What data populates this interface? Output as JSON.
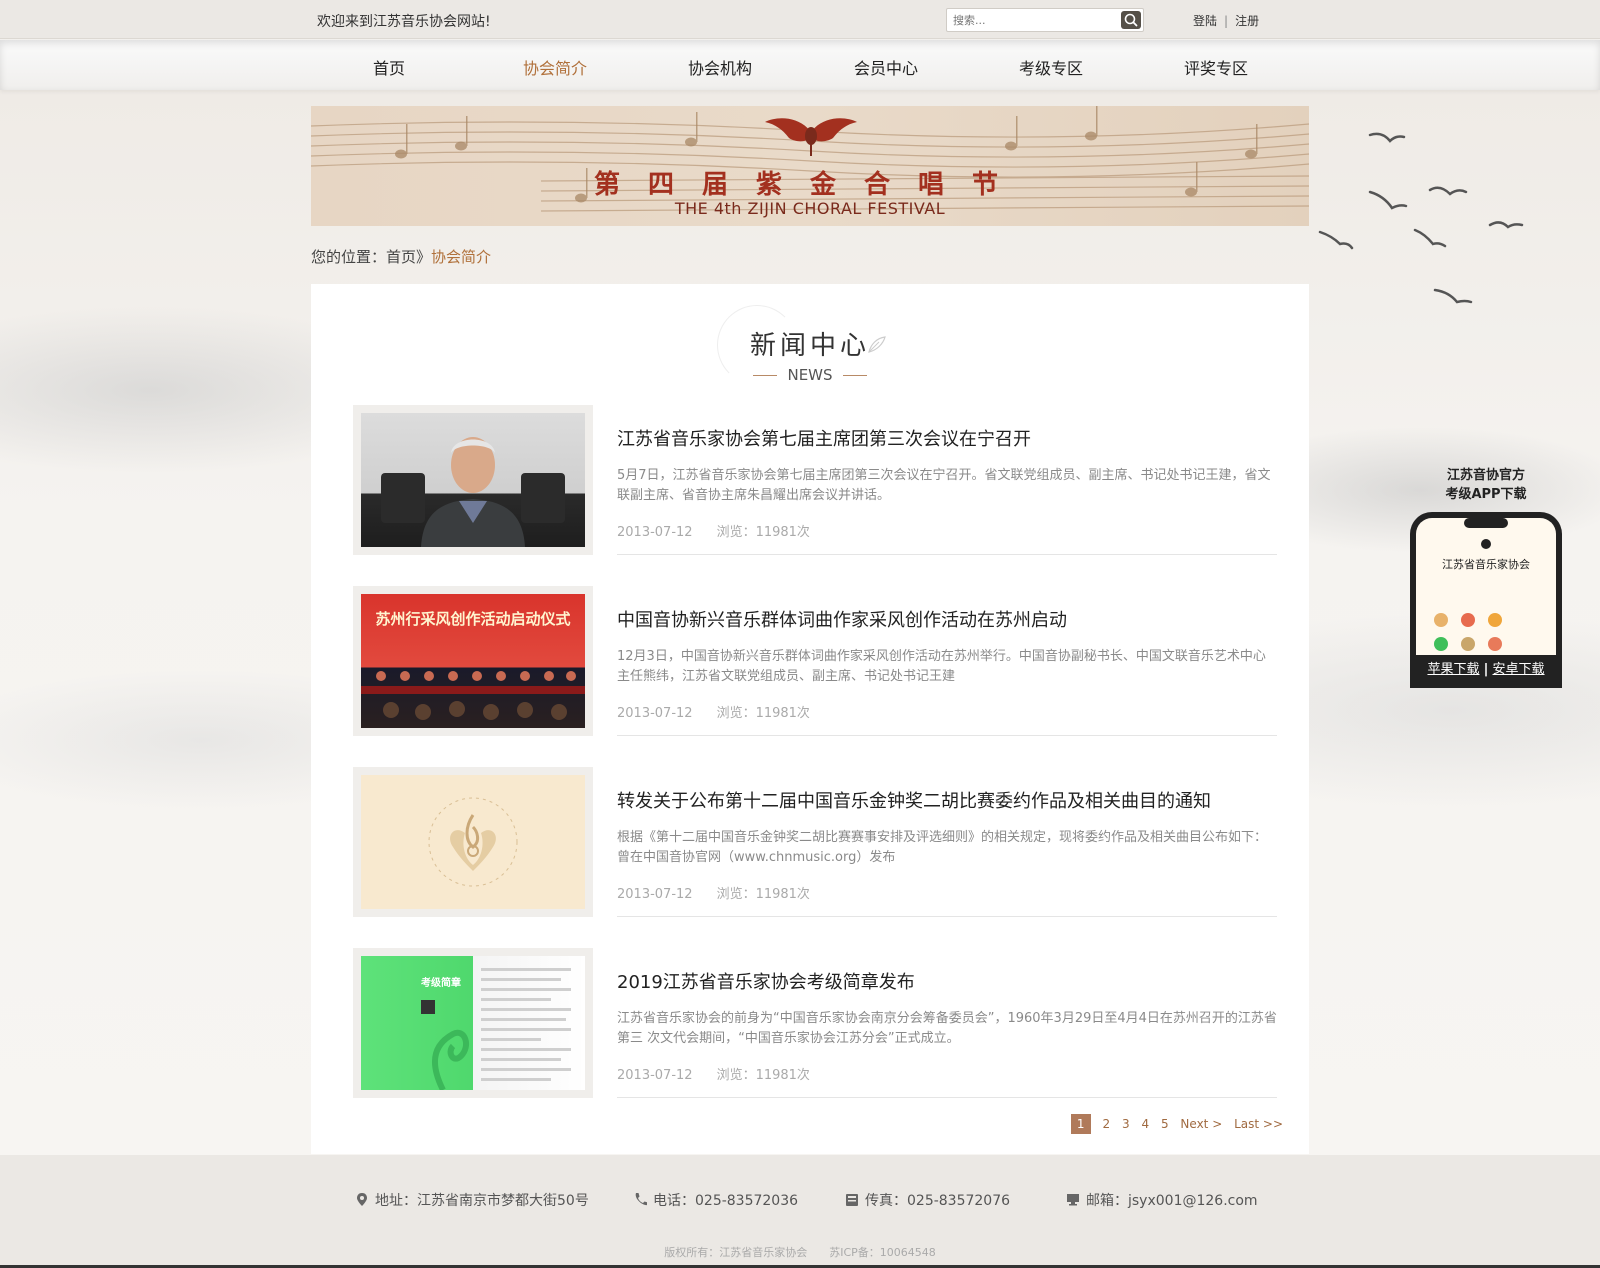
{
  "topbar": {
    "welcome": "欢迎来到江苏音乐协会网站!",
    "search_placeholder": "搜索...",
    "login": "登陆",
    "separator": "|",
    "register": "注册"
  },
  "nav": {
    "items": [
      {
        "label": "首页"
      },
      {
        "label": "协会简介"
      },
      {
        "label": "协会机构"
      },
      {
        "label": "会员中心"
      },
      {
        "label": "考级专区"
      },
      {
        "label": "评奖专区"
      }
    ],
    "active": "协会简介"
  },
  "banner": {
    "title": "第四届紫金合唱节",
    "subtitle": "THE 4th ZIJIN CHORAL FESTIVAL"
  },
  "breadcrumb": {
    "prefix": "您的位置：",
    "home": "首页",
    "arrow": "》",
    "current": "协会简介"
  },
  "section": {
    "title": "新闻中心",
    "subtitle": "NEWS"
  },
  "news": [
    {
      "title": "江苏省音乐家协会第七届主席团第三次会议在宁召开",
      "desc": "5月7日，江苏省音乐家协会第七届主席团第三次会议在宁召开。省文联党组成员、副主席、书记处书记王建，省文联副主席、省音协主席朱昌耀出席会议并讲话。",
      "date": "2013-07-12",
      "views": "浏览：11981次"
    },
    {
      "title": "中国音协新兴音乐群体词曲作家采风创作活动在苏州启动",
      "desc": "12月3日，中国音协新兴音乐群体词曲作家采风创作活动在苏州举行。中国音协副秘书长、中国文联音乐艺术中心主任熊纬，江苏省文联党组成员、副主席、书记处书记王建",
      "date": "2013-07-12",
      "views": "浏览：11981次",
      "thumb_text": "苏州行采风创作活动启动仪式"
    },
    {
      "title": "转发关于公布第十二届中国音乐金钟奖二胡比赛委约作品及相关曲目的通知",
      "desc": "根据《第十二届中国音乐金钟奖二胡比赛赛事安排及评选细则》的相关规定，现将委约作品及相关曲目公布如下：曾在中国音协官网（www.chnmusic.org）发布",
      "date": "2013-07-12",
      "views": "浏览：11981次"
    },
    {
      "title": "2019江苏省音乐家协会考级简章发布",
      "desc": "江苏省音乐家协会的前身为“中国音乐家协会南京分会筹备委员会”，1960年3月29日至4月4日在苏州召开的江苏省第三 次文代会期间，“中国音乐家协会江苏分会”正式成立。",
      "date": "2013-07-12",
      "views": "浏览：11981次",
      "thumb_text": "考级简章"
    }
  ],
  "pager": {
    "pages": [
      "1",
      "2",
      "3",
      "4",
      "5"
    ],
    "current": "1",
    "next": "Next >",
    "last": "Last >>"
  },
  "app": {
    "title_line1": "江苏音协官方",
    "title_line2": "考级APP下载",
    "phone_name": "江苏省音乐家协会",
    "ios": "苹果下载",
    "sep": "|",
    "android": "安卓下载"
  },
  "footer": {
    "address": "地址：江苏省南京市梦都大街50号",
    "phone": "电话：025-83572036",
    "fax": "传真：025-83572076",
    "email": "邮箱：jsyx001@126.com",
    "copyright": "版权所有：江苏省音乐家协会",
    "icp": "苏ICP备：10064548"
  },
  "colors": {
    "accent": "#b0703a",
    "banner_red": "#a3301f",
    "footer_bg": "#ebe8e4"
  }
}
